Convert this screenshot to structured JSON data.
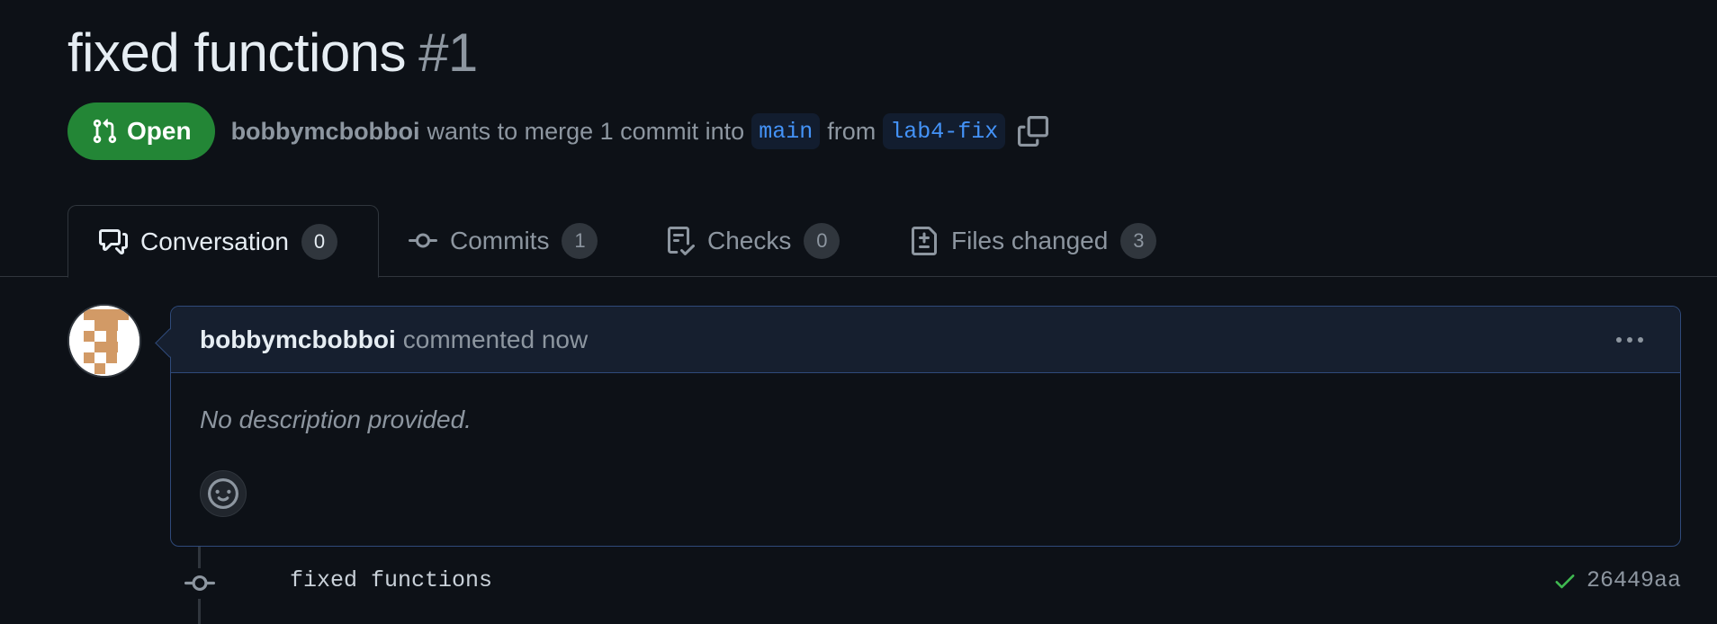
{
  "pr": {
    "title": "fixed functions",
    "number": "#1",
    "state": "Open",
    "author": "bobbymcbobboi",
    "merge_text": "wants to merge 1 commit into",
    "base_branch": "main",
    "from_text": "from",
    "head_branch": "lab4-fix"
  },
  "tabs": [
    {
      "label": "Conversation",
      "count": "0",
      "icon": "conversation-icon",
      "active": true
    },
    {
      "label": "Commits",
      "count": "1",
      "icon": "commit-icon"
    },
    {
      "label": "Checks",
      "count": "0",
      "icon": "checklist-icon"
    },
    {
      "label": "Files changed",
      "count": "3",
      "icon": "file-diff-icon"
    }
  ],
  "comment": {
    "author": "bobbymcbobboi",
    "action": "commented now",
    "body": "No description provided."
  },
  "commit": {
    "message": "fixed functions",
    "sha": "26449aa",
    "status": "success"
  },
  "colors": {
    "background": "#0d1117",
    "open_badge": "#238636",
    "branch_text": "#4493f8",
    "success": "#3fb950",
    "comment_border": "#2f4a7a"
  }
}
